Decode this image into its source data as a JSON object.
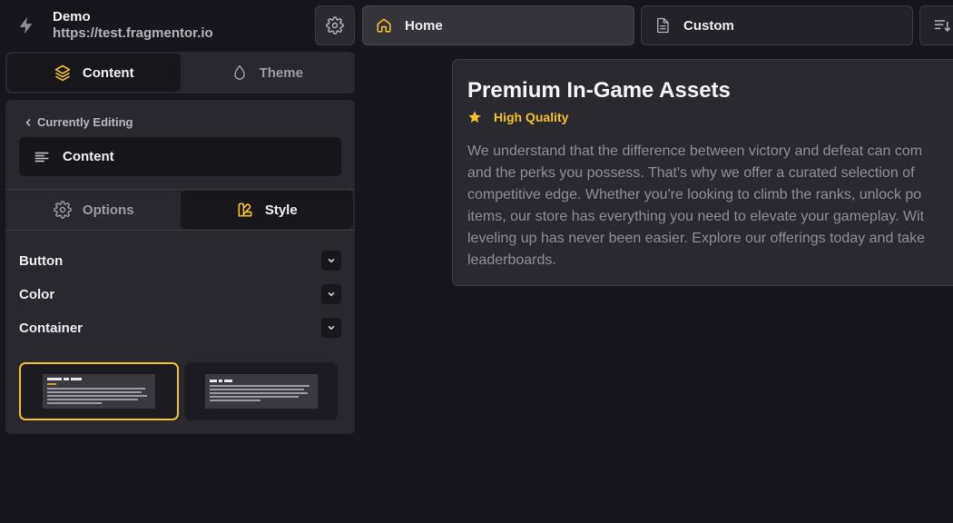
{
  "header": {
    "site_name": "Demo",
    "site_url": "https://test.fragmentor.io",
    "brand_icon": "bolt-icon",
    "settings_icon": "gear-icon"
  },
  "pages": [
    {
      "label": "Home",
      "icon": "home-icon",
      "active": true
    },
    {
      "label": "Custom",
      "icon": "file-icon",
      "active": false
    }
  ],
  "sidebar": {
    "main_tabs": [
      {
        "label": "Content",
        "icon": "layers-icon",
        "active": true
      },
      {
        "label": "Theme",
        "icon": "droplet-icon",
        "active": false
      }
    ],
    "back_label": "Currently Editing",
    "editing_item": "Content",
    "sub_tabs": [
      {
        "label": "Options",
        "icon": "gear-icon",
        "active": false
      },
      {
        "label": "Style",
        "icon": "swatches-icon",
        "active": true
      }
    ],
    "accordions": [
      {
        "label": "Button"
      },
      {
        "label": "Color"
      },
      {
        "label": "Container"
      }
    ],
    "selected_template": 0
  },
  "preview": {
    "title": "Premium In-Game Assets",
    "badge": "High Quality",
    "body_lines": [
      "We understand that the difference between victory and defeat can com",
      "and the perks you possess. That's why we offer a curated selection of",
      "competitive edge. Whether you're looking to climb the ranks, unlock po",
      "items, our store has everything you need to elevate your gameplay. Wit",
      "leveling up has never been easier. Explore our offerings today and take",
      "leaderboards."
    ]
  },
  "colors": {
    "accent": "#f2c230",
    "background": "#17161c",
    "panel": "#29282f"
  }
}
